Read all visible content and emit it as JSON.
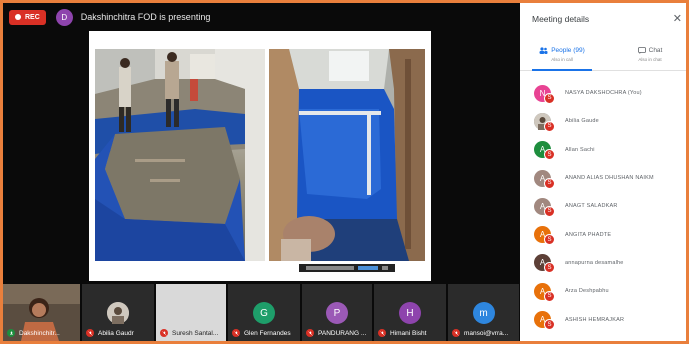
{
  "topbar": {
    "rec_label": "REC",
    "presenter_initial": "D",
    "presenter_color": "#8e44ad",
    "presenting_text": "Dakshinchitra FOD is presenting"
  },
  "tiles": [
    {
      "name": "Dakshinchitr...",
      "initial": "",
      "color": "#6b5a4a",
      "mic": "on"
    },
    {
      "name": "Abilia Gaudr",
      "initial": "",
      "color": "#3a3a3a",
      "mic": "off"
    },
    {
      "name": "Suresh Santal...",
      "initial": "",
      "color": "#cfcfcf",
      "mic": "off"
    },
    {
      "name": "Glen Fernandes",
      "initial": "G",
      "color": "#1e9e6a",
      "mic": "off"
    },
    {
      "name": "PANDURANG ...",
      "initial": "P",
      "color": "#9b59b6",
      "mic": "off"
    },
    {
      "name": "Himani Bisht",
      "initial": "H",
      "color": "#8e44ad",
      "mic": "off"
    },
    {
      "name": "mansoi@vrra...",
      "initial": "m",
      "color": "#2e86de",
      "mic": "off"
    }
  ],
  "panel": {
    "title": "Meeting details",
    "close_icon": "close-icon",
    "people_tab_label": "People (99)",
    "people_tab_sub": "Also in call",
    "chat_tab_label": "Chat",
    "chat_tab_sub": "Also in chat"
  },
  "participants": [
    {
      "initial": "N",
      "color": "#e84393",
      "name": "NASYA DAKSHOCHRA (You)"
    },
    {
      "initial": "",
      "color": "#7a7a7a",
      "name": "Abilia Gaude"
    },
    {
      "initial": "A",
      "color": "#1e8e3e",
      "name": "Allan Sachi"
    },
    {
      "initial": "A",
      "color": "#a1887f",
      "name": "ANAND ALIAS DHUSHAN NAIKM"
    },
    {
      "initial": "A",
      "color": "#a1887f",
      "name": "ANAGT SALADKAR"
    },
    {
      "initial": "A",
      "color": "#e8710a",
      "name": "ANGITA PHADTE"
    },
    {
      "initial": "A",
      "color": "#5d4037",
      "name": "annapurna desamalhe"
    },
    {
      "initial": "A",
      "color": "#e8710a",
      "name": "Arza Deshpabhu"
    },
    {
      "initial": "A",
      "color": "#e8710a",
      "name": "ASHISH HEMRAJKAR"
    }
  ]
}
